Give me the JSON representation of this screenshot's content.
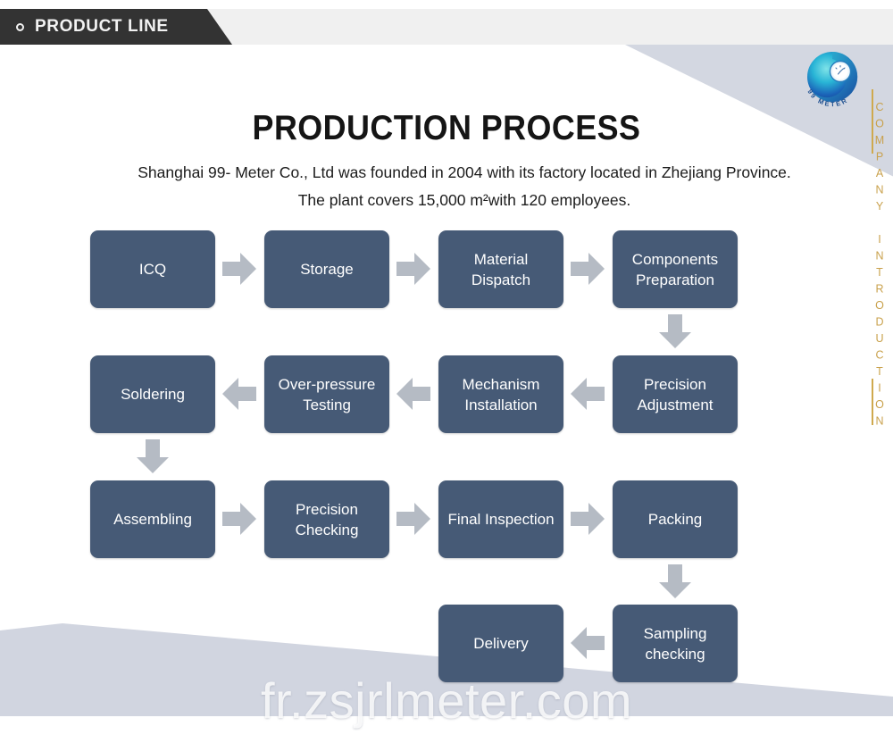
{
  "header": {
    "banner_label": "PRODUCT LINE",
    "bullet_icon": "circle-outline-icon",
    "banner_bg": "#333333"
  },
  "brand": {
    "logo_icon": "99-meter-swirl-logo",
    "logo_text": "99 METER",
    "sidebar_label": "COMPANY INTRODUCTION",
    "sidebar_color": "#c9a14c"
  },
  "main": {
    "title": "PRODUCTION PROCESS",
    "description": "Shanghai 99- Meter Co., Ltd was founded in 2004 with its factory located in Zhejiang Province. The plant covers 15,000 m²with 120 employees."
  },
  "theme": {
    "node_bg": "#465a76",
    "node_text": "#ffffff",
    "arrow_color": "#b5bbc4",
    "deco_color": "#d1d5e0"
  },
  "flow": {
    "nodes": [
      {
        "id": "icq",
        "label": "ICQ"
      },
      {
        "id": "storage",
        "label": "Storage"
      },
      {
        "id": "material-dispatch",
        "label": "Material Dispatch"
      },
      {
        "id": "components-preparation",
        "label": "Components Preparation"
      },
      {
        "id": "precision-adjustment",
        "label": "Precision Adjustment"
      },
      {
        "id": "mechanism-installation",
        "label": "Mechanism Installation"
      },
      {
        "id": "over-pressure-testing",
        "label": "Over-pressure Testing"
      },
      {
        "id": "soldering",
        "label": "Soldering"
      },
      {
        "id": "assembling",
        "label": "Assembling"
      },
      {
        "id": "precision-checking",
        "label": "Precision Checking"
      },
      {
        "id": "final-inspection",
        "label": "Final Inspection"
      },
      {
        "id": "packing",
        "label": "Packing"
      },
      {
        "id": "sampling-checking",
        "label": "Sampling checking"
      },
      {
        "id": "delivery",
        "label": "Delivery"
      }
    ]
  },
  "watermark": {
    "text": "fr.zsjrlmeter.com"
  }
}
